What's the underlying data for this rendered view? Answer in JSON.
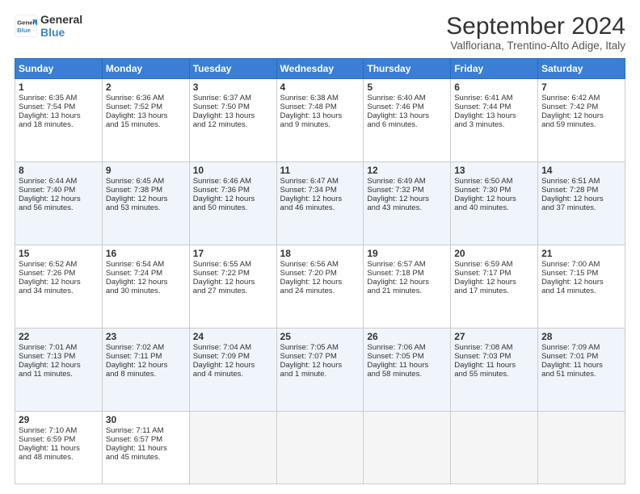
{
  "header": {
    "logo_line1": "General",
    "logo_line2": "Blue",
    "main_title": "September 2024",
    "subtitle": "Valfloriana, Trentino-Alto Adige, Italy"
  },
  "days_of_week": [
    "Sunday",
    "Monday",
    "Tuesday",
    "Wednesday",
    "Thursday",
    "Friday",
    "Saturday"
  ],
  "weeks": [
    [
      {
        "day": "1",
        "lines": [
          "Sunrise: 6:35 AM",
          "Sunset: 7:54 PM",
          "Daylight: 13 hours",
          "and 18 minutes."
        ]
      },
      {
        "day": "2",
        "lines": [
          "Sunrise: 6:36 AM",
          "Sunset: 7:52 PM",
          "Daylight: 13 hours",
          "and 15 minutes."
        ]
      },
      {
        "day": "3",
        "lines": [
          "Sunrise: 6:37 AM",
          "Sunset: 7:50 PM",
          "Daylight: 13 hours",
          "and 12 minutes."
        ]
      },
      {
        "day": "4",
        "lines": [
          "Sunrise: 6:38 AM",
          "Sunset: 7:48 PM",
          "Daylight: 13 hours",
          "and 9 minutes."
        ]
      },
      {
        "day": "5",
        "lines": [
          "Sunrise: 6:40 AM",
          "Sunset: 7:46 PM",
          "Daylight: 13 hours",
          "and 6 minutes."
        ]
      },
      {
        "day": "6",
        "lines": [
          "Sunrise: 6:41 AM",
          "Sunset: 7:44 PM",
          "Daylight: 13 hours",
          "and 3 minutes."
        ]
      },
      {
        "day": "7",
        "lines": [
          "Sunrise: 6:42 AM",
          "Sunset: 7:42 PM",
          "Daylight: 12 hours",
          "and 59 minutes."
        ]
      }
    ],
    [
      {
        "day": "8",
        "lines": [
          "Sunrise: 6:44 AM",
          "Sunset: 7:40 PM",
          "Daylight: 12 hours",
          "and 56 minutes."
        ]
      },
      {
        "day": "9",
        "lines": [
          "Sunrise: 6:45 AM",
          "Sunset: 7:38 PM",
          "Daylight: 12 hours",
          "and 53 minutes."
        ]
      },
      {
        "day": "10",
        "lines": [
          "Sunrise: 6:46 AM",
          "Sunset: 7:36 PM",
          "Daylight: 12 hours",
          "and 50 minutes."
        ]
      },
      {
        "day": "11",
        "lines": [
          "Sunrise: 6:47 AM",
          "Sunset: 7:34 PM",
          "Daylight: 12 hours",
          "and 46 minutes."
        ]
      },
      {
        "day": "12",
        "lines": [
          "Sunrise: 6:49 AM",
          "Sunset: 7:32 PM",
          "Daylight: 12 hours",
          "and 43 minutes."
        ]
      },
      {
        "day": "13",
        "lines": [
          "Sunrise: 6:50 AM",
          "Sunset: 7:30 PM",
          "Daylight: 12 hours",
          "and 40 minutes."
        ]
      },
      {
        "day": "14",
        "lines": [
          "Sunrise: 6:51 AM",
          "Sunset: 7:28 PM",
          "Daylight: 12 hours",
          "and 37 minutes."
        ]
      }
    ],
    [
      {
        "day": "15",
        "lines": [
          "Sunrise: 6:52 AM",
          "Sunset: 7:26 PM",
          "Daylight: 12 hours",
          "and 34 minutes."
        ]
      },
      {
        "day": "16",
        "lines": [
          "Sunrise: 6:54 AM",
          "Sunset: 7:24 PM",
          "Daylight: 12 hours",
          "and 30 minutes."
        ]
      },
      {
        "day": "17",
        "lines": [
          "Sunrise: 6:55 AM",
          "Sunset: 7:22 PM",
          "Daylight: 12 hours",
          "and 27 minutes."
        ]
      },
      {
        "day": "18",
        "lines": [
          "Sunrise: 6:56 AM",
          "Sunset: 7:20 PM",
          "Daylight: 12 hours",
          "and 24 minutes."
        ]
      },
      {
        "day": "19",
        "lines": [
          "Sunrise: 6:57 AM",
          "Sunset: 7:18 PM",
          "Daylight: 12 hours",
          "and 21 minutes."
        ]
      },
      {
        "day": "20",
        "lines": [
          "Sunrise: 6:59 AM",
          "Sunset: 7:17 PM",
          "Daylight: 12 hours",
          "and 17 minutes."
        ]
      },
      {
        "day": "21",
        "lines": [
          "Sunrise: 7:00 AM",
          "Sunset: 7:15 PM",
          "Daylight: 12 hours",
          "and 14 minutes."
        ]
      }
    ],
    [
      {
        "day": "22",
        "lines": [
          "Sunrise: 7:01 AM",
          "Sunset: 7:13 PM",
          "Daylight: 12 hours",
          "and 11 minutes."
        ]
      },
      {
        "day": "23",
        "lines": [
          "Sunrise: 7:02 AM",
          "Sunset: 7:11 PM",
          "Daylight: 12 hours",
          "and 8 minutes."
        ]
      },
      {
        "day": "24",
        "lines": [
          "Sunrise: 7:04 AM",
          "Sunset: 7:09 PM",
          "Daylight: 12 hours",
          "and 4 minutes."
        ]
      },
      {
        "day": "25",
        "lines": [
          "Sunrise: 7:05 AM",
          "Sunset: 7:07 PM",
          "Daylight: 12 hours",
          "and 1 minute."
        ]
      },
      {
        "day": "26",
        "lines": [
          "Sunrise: 7:06 AM",
          "Sunset: 7:05 PM",
          "Daylight: 11 hours",
          "and 58 minutes."
        ]
      },
      {
        "day": "27",
        "lines": [
          "Sunrise: 7:08 AM",
          "Sunset: 7:03 PM",
          "Daylight: 11 hours",
          "and 55 minutes."
        ]
      },
      {
        "day": "28",
        "lines": [
          "Sunrise: 7:09 AM",
          "Sunset: 7:01 PM",
          "Daylight: 11 hours",
          "and 51 minutes."
        ]
      }
    ],
    [
      {
        "day": "29",
        "lines": [
          "Sunrise: 7:10 AM",
          "Sunset: 6:59 PM",
          "Daylight: 11 hours",
          "and 48 minutes."
        ]
      },
      {
        "day": "30",
        "lines": [
          "Sunrise: 7:11 AM",
          "Sunset: 6:57 PM",
          "Daylight: 11 hours",
          "and 45 minutes."
        ]
      },
      null,
      null,
      null,
      null,
      null
    ]
  ]
}
